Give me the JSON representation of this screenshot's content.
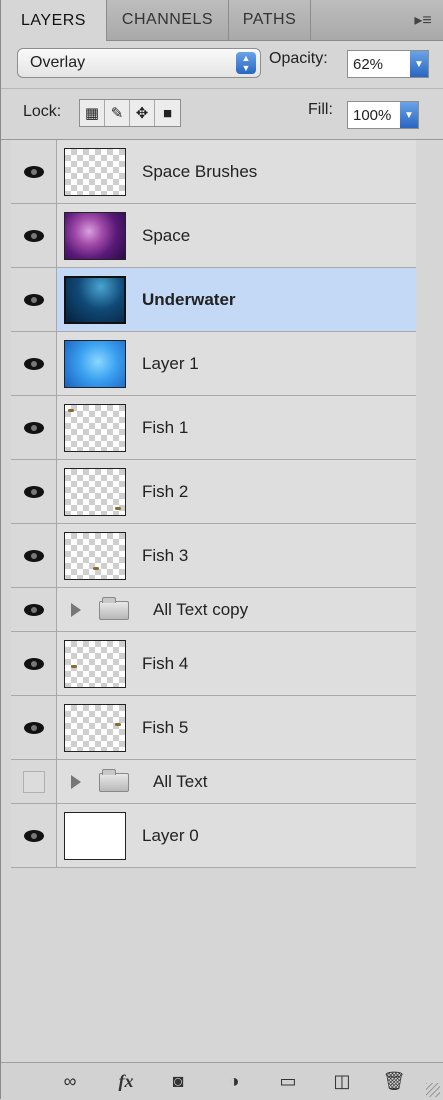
{
  "tabs": [
    "LAYERS",
    "CHANNELS",
    "PATHS"
  ],
  "menu_icon": "panel-menu-icon",
  "blend_mode": "Overlay",
  "opacity_label": "Opacity:",
  "opacity_value": "62%",
  "lock_label": "Lock:",
  "fill_label": "Fill:",
  "fill_value": "100%",
  "layers": [
    {
      "name": "Space Brushes",
      "visible": true,
      "thumb": "transparent"
    },
    {
      "name": "Space",
      "visible": true,
      "thumb": "space"
    },
    {
      "name": "Underwater",
      "visible": true,
      "thumb": "underwater",
      "selected": true
    },
    {
      "name": "Layer 1",
      "visible": true,
      "thumb": "blue-gradient"
    },
    {
      "name": "Fish 1",
      "visible": true,
      "thumb": "transparent"
    },
    {
      "name": "Fish 2",
      "visible": true,
      "thumb": "transparent"
    },
    {
      "name": "Fish 3",
      "visible": true,
      "thumb": "transparent"
    },
    {
      "name": "All Text copy",
      "visible": true,
      "group": true
    },
    {
      "name": "Fish 4",
      "visible": true,
      "thumb": "transparent"
    },
    {
      "name": "Fish 5",
      "visible": true,
      "thumb": "transparent"
    },
    {
      "name": "All Text",
      "visible": false,
      "group": true
    },
    {
      "name": "Layer 0",
      "visible": true,
      "thumb": "white"
    }
  ],
  "bottom_tools": [
    "link-icon",
    "fx-icon",
    "mask-icon",
    "adjustment-icon",
    "new-group-icon",
    "new-layer-icon",
    "trash-icon"
  ],
  "fx_label": "fx",
  "colors": {
    "selected_row": "#c4d9f6",
    "accent": "#2a66c2"
  }
}
